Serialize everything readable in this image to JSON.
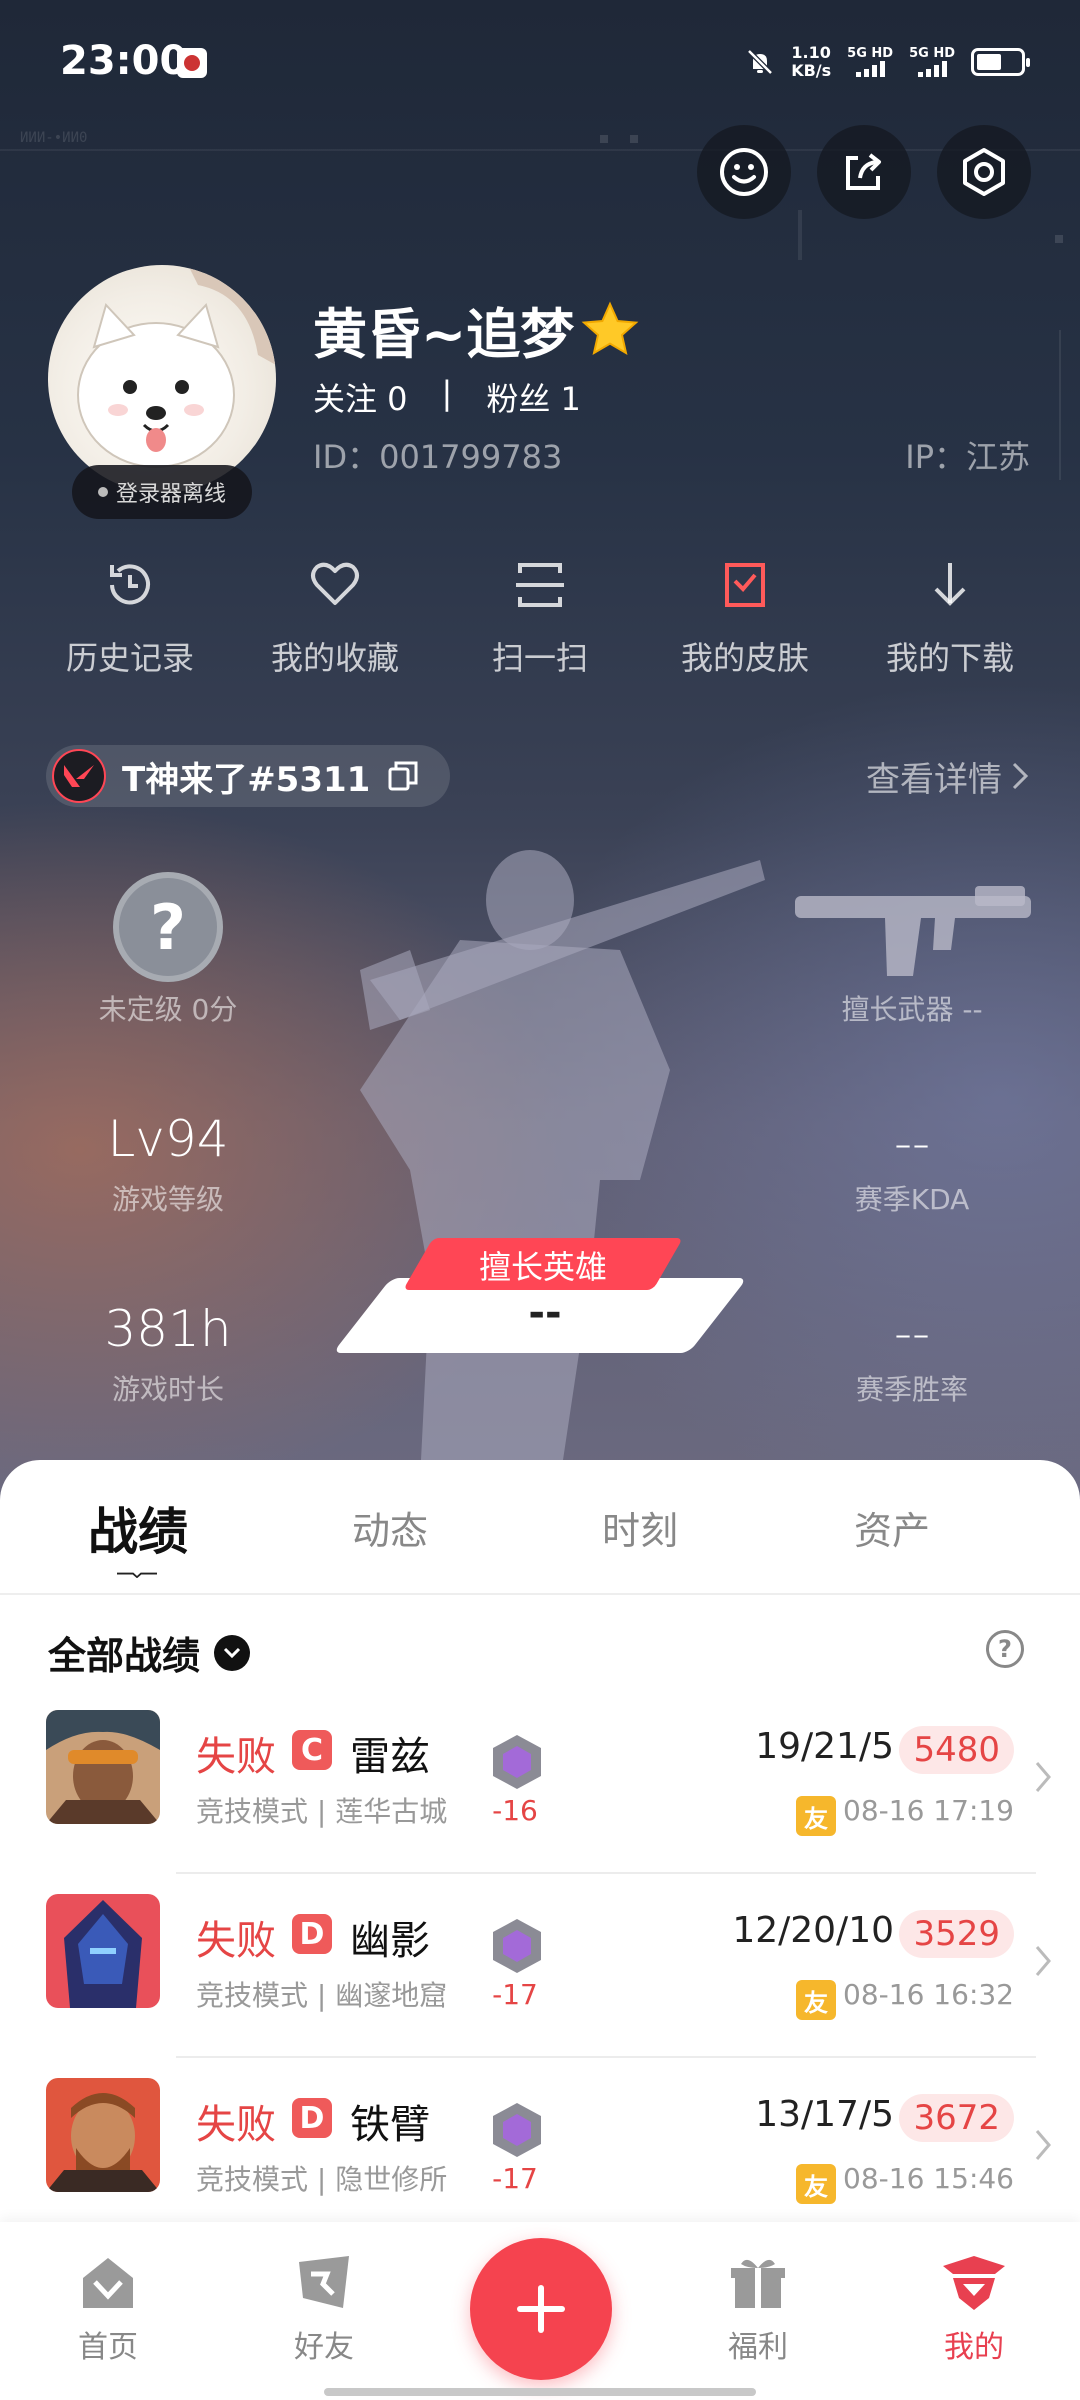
{
  "status_bar": {
    "time": "23:00",
    "net_speed_value": "1.10",
    "net_speed_unit": "KB/s",
    "sim1": "5G HD",
    "sim2": "5G HD"
  },
  "profile": {
    "username": "黄昏~追梦",
    "following": "关注 0",
    "followers": "粉丝 1",
    "separator": "|",
    "id": "ID：001799783",
    "ip": "IP：江苏",
    "avatar_status": "登录器离线"
  },
  "quick_actions": [
    {
      "label": "历史记录",
      "icon": "history-icon"
    },
    {
      "label": "我的收藏",
      "icon": "heart-icon"
    },
    {
      "label": "扫一扫",
      "icon": "scan-icon"
    },
    {
      "label": "我的皮肤",
      "icon": "skin-icon"
    },
    {
      "label": "我的下载",
      "icon": "download-icon"
    }
  ],
  "game_account": {
    "name": "T神来了#5311",
    "view_detail": "查看详情"
  },
  "stats": {
    "rank_symbol": "?",
    "rank_label": "未定级 0分",
    "weapon_label": "擅长武器 --",
    "level_value": "Lv94",
    "level_label": "游戏等级",
    "kda_value": "--",
    "kda_label": "赛季KDA",
    "hours_value": "381h",
    "hours_label": "游戏时长",
    "winrate_value": "--",
    "winrate_label": "赛季胜率",
    "hero_ribbon": "擅长英雄",
    "hero_value": "--"
  },
  "tabs": [
    "战绩",
    "动态",
    "时刻",
    "资产"
  ],
  "records": {
    "title": "全部战绩",
    "matches": [
      {
        "result": "失败",
        "grade": "C",
        "agent": "雷兹",
        "mode": "竞技模式 | 莲华古城",
        "rr": "-16",
        "kda": "19/21/5",
        "score": "5480",
        "friend": "友",
        "time": "08-16 17:19"
      },
      {
        "result": "失败",
        "grade": "D",
        "agent": "幽影",
        "mode": "竞技模式 | 幽邃地窟",
        "rr": "-17",
        "kda": "12/20/10",
        "score": "3529",
        "friend": "友",
        "time": "08-16 16:32"
      },
      {
        "result": "失败",
        "grade": "D",
        "agent": "铁臂",
        "mode": "竞技模式 | 隐世修所",
        "rr": "-17",
        "kda": "13/17/5",
        "score": "3672",
        "friend": "友",
        "time": "08-16 15:46"
      }
    ]
  },
  "bottom_nav": [
    {
      "label": "首页"
    },
    {
      "label": "好友"
    },
    {
      "label": "福利"
    },
    {
      "label": "我的"
    }
  ],
  "colors": {
    "accent": "#f5434f",
    "loss": "#e54545"
  }
}
